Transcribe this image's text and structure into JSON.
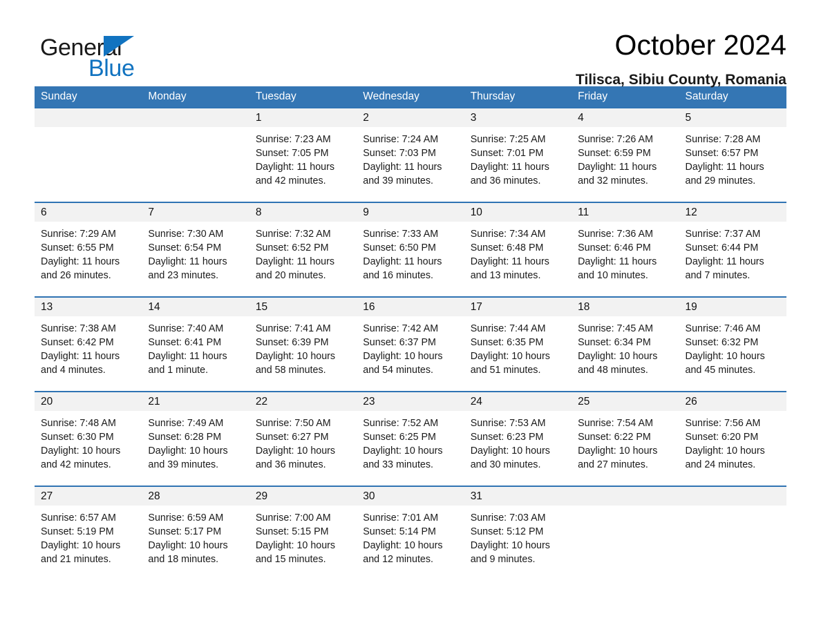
{
  "brand": {
    "name_part1": "General",
    "name_part2": "Blue",
    "triangle_color": "#1173c0"
  },
  "header": {
    "month_title": "October 2024",
    "location": "Tilisca, Sibiu County, Romania"
  },
  "theme": {
    "header_blue": "#3476b4",
    "row_border_blue": "#2f73b3",
    "daynum_band": "#f2f2f2"
  },
  "weekdays": [
    "Sunday",
    "Monday",
    "Tuesday",
    "Wednesday",
    "Thursday",
    "Friday",
    "Saturday"
  ],
  "weeks": [
    {
      "days": [
        {
          "num": "",
          "sunrise": "",
          "sunset": "",
          "daylight_1": "",
          "daylight_2": "",
          "empty": true
        },
        {
          "num": "",
          "sunrise": "",
          "sunset": "",
          "daylight_1": "",
          "daylight_2": "",
          "empty": true
        },
        {
          "num": "1",
          "sunrise": "Sunrise: 7:23 AM",
          "sunset": "Sunset: 7:05 PM",
          "daylight_1": "Daylight: 11 hours",
          "daylight_2": "and 42 minutes.",
          "empty": false
        },
        {
          "num": "2",
          "sunrise": "Sunrise: 7:24 AM",
          "sunset": "Sunset: 7:03 PM",
          "daylight_1": "Daylight: 11 hours",
          "daylight_2": "and 39 minutes.",
          "empty": false
        },
        {
          "num": "3",
          "sunrise": "Sunrise: 7:25 AM",
          "sunset": "Sunset: 7:01 PM",
          "daylight_1": "Daylight: 11 hours",
          "daylight_2": "and 36 minutes.",
          "empty": false
        },
        {
          "num": "4",
          "sunrise": "Sunrise: 7:26 AM",
          "sunset": "Sunset: 6:59 PM",
          "daylight_1": "Daylight: 11 hours",
          "daylight_2": "and 32 minutes.",
          "empty": false
        },
        {
          "num": "5",
          "sunrise": "Sunrise: 7:28 AM",
          "sunset": "Sunset: 6:57 PM",
          "daylight_1": "Daylight: 11 hours",
          "daylight_2": "and 29 minutes.",
          "empty": false
        }
      ]
    },
    {
      "days": [
        {
          "num": "6",
          "sunrise": "Sunrise: 7:29 AM",
          "sunset": "Sunset: 6:55 PM",
          "daylight_1": "Daylight: 11 hours",
          "daylight_2": "and 26 minutes.",
          "empty": false
        },
        {
          "num": "7",
          "sunrise": "Sunrise: 7:30 AM",
          "sunset": "Sunset: 6:54 PM",
          "daylight_1": "Daylight: 11 hours",
          "daylight_2": "and 23 minutes.",
          "empty": false
        },
        {
          "num": "8",
          "sunrise": "Sunrise: 7:32 AM",
          "sunset": "Sunset: 6:52 PM",
          "daylight_1": "Daylight: 11 hours",
          "daylight_2": "and 20 minutes.",
          "empty": false
        },
        {
          "num": "9",
          "sunrise": "Sunrise: 7:33 AM",
          "sunset": "Sunset: 6:50 PM",
          "daylight_1": "Daylight: 11 hours",
          "daylight_2": "and 16 minutes.",
          "empty": false
        },
        {
          "num": "10",
          "sunrise": "Sunrise: 7:34 AM",
          "sunset": "Sunset: 6:48 PM",
          "daylight_1": "Daylight: 11 hours",
          "daylight_2": "and 13 minutes.",
          "empty": false
        },
        {
          "num": "11",
          "sunrise": "Sunrise: 7:36 AM",
          "sunset": "Sunset: 6:46 PM",
          "daylight_1": "Daylight: 11 hours",
          "daylight_2": "and 10 minutes.",
          "empty": false
        },
        {
          "num": "12",
          "sunrise": "Sunrise: 7:37 AM",
          "sunset": "Sunset: 6:44 PM",
          "daylight_1": "Daylight: 11 hours",
          "daylight_2": "and 7 minutes.",
          "empty": false
        }
      ]
    },
    {
      "days": [
        {
          "num": "13",
          "sunrise": "Sunrise: 7:38 AM",
          "sunset": "Sunset: 6:42 PM",
          "daylight_1": "Daylight: 11 hours",
          "daylight_2": "and 4 minutes.",
          "empty": false
        },
        {
          "num": "14",
          "sunrise": "Sunrise: 7:40 AM",
          "sunset": "Sunset: 6:41 PM",
          "daylight_1": "Daylight: 11 hours",
          "daylight_2": "and 1 minute.",
          "empty": false
        },
        {
          "num": "15",
          "sunrise": "Sunrise: 7:41 AM",
          "sunset": "Sunset: 6:39 PM",
          "daylight_1": "Daylight: 10 hours",
          "daylight_2": "and 58 minutes.",
          "empty": false
        },
        {
          "num": "16",
          "sunrise": "Sunrise: 7:42 AM",
          "sunset": "Sunset: 6:37 PM",
          "daylight_1": "Daylight: 10 hours",
          "daylight_2": "and 54 minutes.",
          "empty": false
        },
        {
          "num": "17",
          "sunrise": "Sunrise: 7:44 AM",
          "sunset": "Sunset: 6:35 PM",
          "daylight_1": "Daylight: 10 hours",
          "daylight_2": "and 51 minutes.",
          "empty": false
        },
        {
          "num": "18",
          "sunrise": "Sunrise: 7:45 AM",
          "sunset": "Sunset: 6:34 PM",
          "daylight_1": "Daylight: 10 hours",
          "daylight_2": "and 48 minutes.",
          "empty": false
        },
        {
          "num": "19",
          "sunrise": "Sunrise: 7:46 AM",
          "sunset": "Sunset: 6:32 PM",
          "daylight_1": "Daylight: 10 hours",
          "daylight_2": "and 45 minutes.",
          "empty": false
        }
      ]
    },
    {
      "days": [
        {
          "num": "20",
          "sunrise": "Sunrise: 7:48 AM",
          "sunset": "Sunset: 6:30 PM",
          "daylight_1": "Daylight: 10 hours",
          "daylight_2": "and 42 minutes.",
          "empty": false
        },
        {
          "num": "21",
          "sunrise": "Sunrise: 7:49 AM",
          "sunset": "Sunset: 6:28 PM",
          "daylight_1": "Daylight: 10 hours",
          "daylight_2": "and 39 minutes.",
          "empty": false
        },
        {
          "num": "22",
          "sunrise": "Sunrise: 7:50 AM",
          "sunset": "Sunset: 6:27 PM",
          "daylight_1": "Daylight: 10 hours",
          "daylight_2": "and 36 minutes.",
          "empty": false
        },
        {
          "num": "23",
          "sunrise": "Sunrise: 7:52 AM",
          "sunset": "Sunset: 6:25 PM",
          "daylight_1": "Daylight: 10 hours",
          "daylight_2": "and 33 minutes.",
          "empty": false
        },
        {
          "num": "24",
          "sunrise": "Sunrise: 7:53 AM",
          "sunset": "Sunset: 6:23 PM",
          "daylight_1": "Daylight: 10 hours",
          "daylight_2": "and 30 minutes.",
          "empty": false
        },
        {
          "num": "25",
          "sunrise": "Sunrise: 7:54 AM",
          "sunset": "Sunset: 6:22 PM",
          "daylight_1": "Daylight: 10 hours",
          "daylight_2": "and 27 minutes.",
          "empty": false
        },
        {
          "num": "26",
          "sunrise": "Sunrise: 7:56 AM",
          "sunset": "Sunset: 6:20 PM",
          "daylight_1": "Daylight: 10 hours",
          "daylight_2": "and 24 minutes.",
          "empty": false
        }
      ]
    },
    {
      "days": [
        {
          "num": "27",
          "sunrise": "Sunrise: 6:57 AM",
          "sunset": "Sunset: 5:19 PM",
          "daylight_1": "Daylight: 10 hours",
          "daylight_2": "and 21 minutes.",
          "empty": false
        },
        {
          "num": "28",
          "sunrise": "Sunrise: 6:59 AM",
          "sunset": "Sunset: 5:17 PM",
          "daylight_1": "Daylight: 10 hours",
          "daylight_2": "and 18 minutes.",
          "empty": false
        },
        {
          "num": "29",
          "sunrise": "Sunrise: 7:00 AM",
          "sunset": "Sunset: 5:15 PM",
          "daylight_1": "Daylight: 10 hours",
          "daylight_2": "and 15 minutes.",
          "empty": false
        },
        {
          "num": "30",
          "sunrise": "Sunrise: 7:01 AM",
          "sunset": "Sunset: 5:14 PM",
          "daylight_1": "Daylight: 10 hours",
          "daylight_2": "and 12 minutes.",
          "empty": false
        },
        {
          "num": "31",
          "sunrise": "Sunrise: 7:03 AM",
          "sunset": "Sunset: 5:12 PM",
          "daylight_1": "Daylight: 10 hours",
          "daylight_2": "and 9 minutes.",
          "empty": false
        },
        {
          "num": "",
          "sunrise": "",
          "sunset": "",
          "daylight_1": "",
          "daylight_2": "",
          "empty": true
        },
        {
          "num": "",
          "sunrise": "",
          "sunset": "",
          "daylight_1": "",
          "daylight_2": "",
          "empty": true
        }
      ]
    }
  ]
}
